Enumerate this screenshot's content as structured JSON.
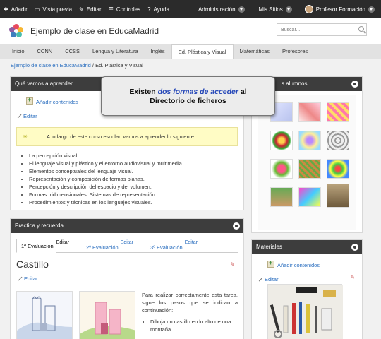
{
  "adminbar": {
    "add": "Añadir",
    "preview": "Vista previa",
    "edit": "Editar",
    "controls": "Controles",
    "help": "Ayuda",
    "administration": "Administración",
    "my_sites": "Mis Sitios",
    "user": "Profesor Formación"
  },
  "header": {
    "site_title": "Ejemplo de clase en EducaMadrid",
    "search_placeholder": "Buscar..."
  },
  "nav": {
    "tabs": [
      {
        "label": "Inicio"
      },
      {
        "label": "CCNN"
      },
      {
        "label": "CCSS"
      },
      {
        "label": "Lengua y Literatura"
      },
      {
        "label": "Inglés"
      },
      {
        "label": "Ed. Plástica y Visual"
      },
      {
        "label": "Matemáticas"
      },
      {
        "label": "Profesores"
      }
    ],
    "active_index": 5
  },
  "breadcrumb": {
    "parent": "Ejemplo de clase en EducaMadrid",
    "separator": "/",
    "current": "Ed. Plástica y Visual"
  },
  "learn_block": {
    "title": "Qué vamos a aprender",
    "add_content": "Añadir contenidos",
    "edit": "Editar",
    "intro": "A lo largo de este curso escolar, vamos a aprender lo siguiente:",
    "items": [
      "La percepción visual.",
      "El lenguaje visual y plástico y el entorno audiovisual y multimedia.",
      "Elementos conceptuales del lenguaje visual.",
      "Representación y composición de formas planas.",
      "Percepción y descripción del espacio y del volumen.",
      "Formas tridimensionales. Sistemas de representación.",
      "Procedimientos y técnicas en los lenguajes visuales."
    ]
  },
  "practice_block": {
    "title": "Practica y recuerda",
    "tabs": [
      {
        "label": "1ª Evaluación",
        "edit": "Editar"
      },
      {
        "label": "2º Evaluación",
        "edit": "Editar"
      },
      {
        "label": "3º Evaluación",
        "edit": "Editar"
      }
    ],
    "heading": "Castillo",
    "edit": "Editar",
    "instructions": "Para realizar correctamente esta tarea, sigue los pasos que se indican a continuación:",
    "step1": "Dibuja un castillo en lo alto de una montaña."
  },
  "students_block": {
    "title_visible": "s alumnos"
  },
  "materials_block": {
    "title": "Materiales",
    "add_content": "Añadir contenidos",
    "edit": "Editar"
  },
  "callout": {
    "prefix": "Existen",
    "highlight": "dos formas de acceder",
    "suffix_line1": "al",
    "line2": "Directorio de ficheros"
  },
  "colors": {
    "adminbar": "#2b2b2b",
    "block_header": "#3d3d3d",
    "link": "#2a6ebf",
    "note_bg": "#fffcc5",
    "callout_highlight": "#2547b8"
  }
}
